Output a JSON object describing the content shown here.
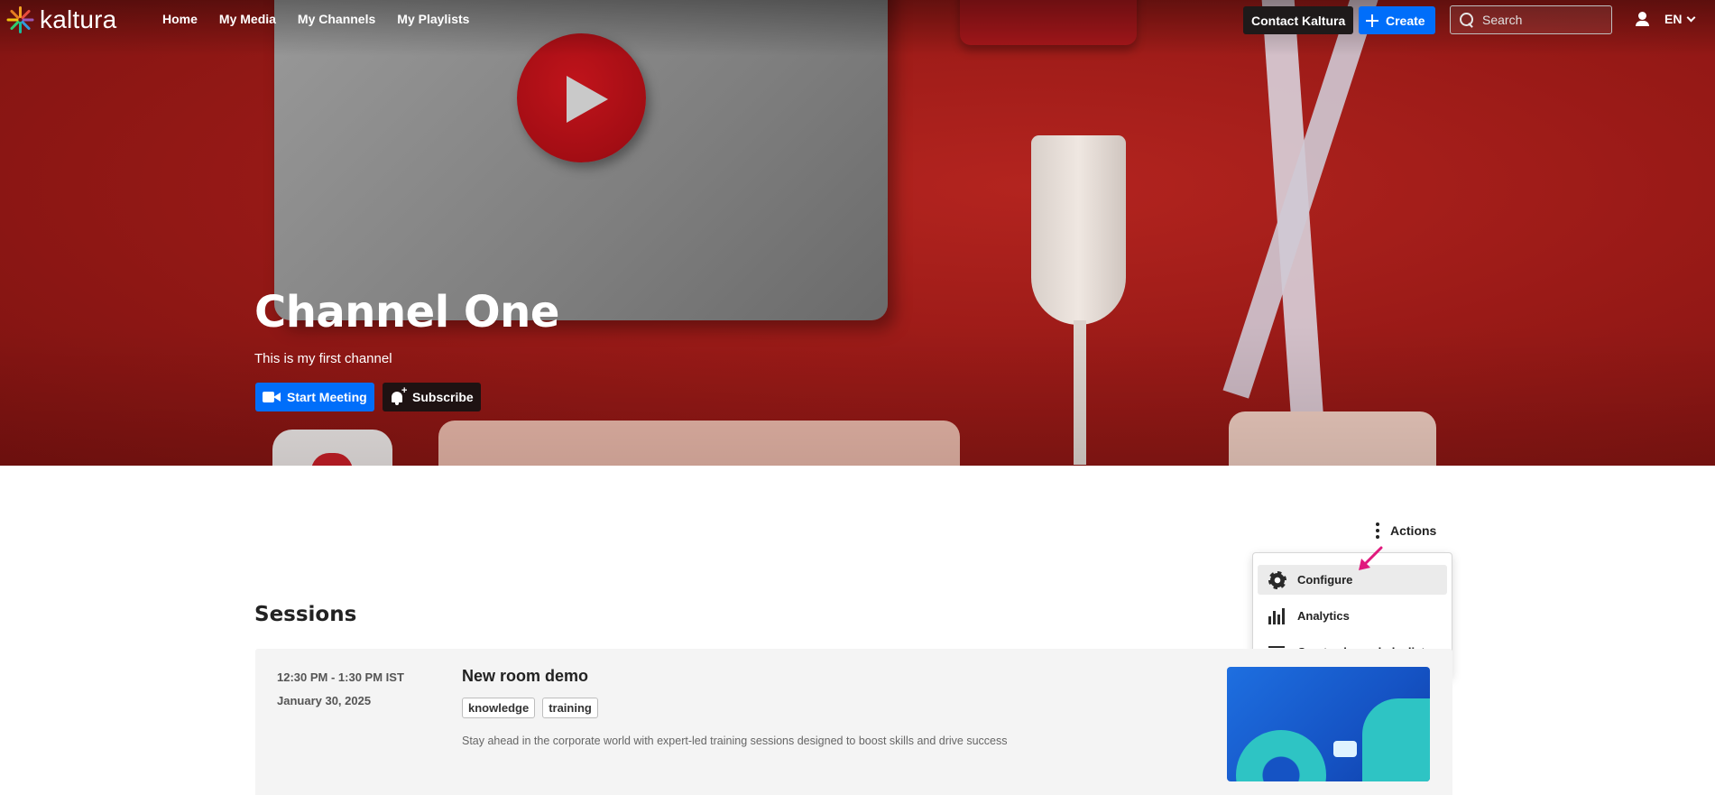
{
  "nav": {
    "logo_text": "kaltura",
    "links": [
      "Home",
      "My Media",
      "My Channels",
      "My Playlists"
    ],
    "contact_label": "Contact Kaltura",
    "create_label": "Create",
    "search_placeholder": "Search",
    "language": "EN"
  },
  "hero": {
    "title": "Channel One",
    "description": "This is my first channel",
    "start_meeting_label": "Start Meeting",
    "subscribe_label": "Subscribe"
  },
  "actions": {
    "label": "Actions",
    "menu": [
      {
        "label": "Configure",
        "icon": "gear-icon",
        "active": true
      },
      {
        "label": "Analytics",
        "icon": "bar-chart-icon",
        "active": false
      },
      {
        "label": "Create channel playlist",
        "icon": "playlist-add-icon",
        "active": false
      }
    ]
  },
  "sessions": {
    "title": "Sessions",
    "items": [
      {
        "time": "12:30 PM - 1:30 PM IST",
        "date": "January 30, 2025",
        "title": "New room demo",
        "tags": [
          "knowledge",
          "training"
        ],
        "description": "Stay ahead in the corporate world with expert-led training sessions designed to boost skills and drive success"
      }
    ]
  },
  "colors": {
    "primary_blue": "#006efa",
    "hero_red": "#9a1a17",
    "annotation_arrow": "#e0197d"
  }
}
